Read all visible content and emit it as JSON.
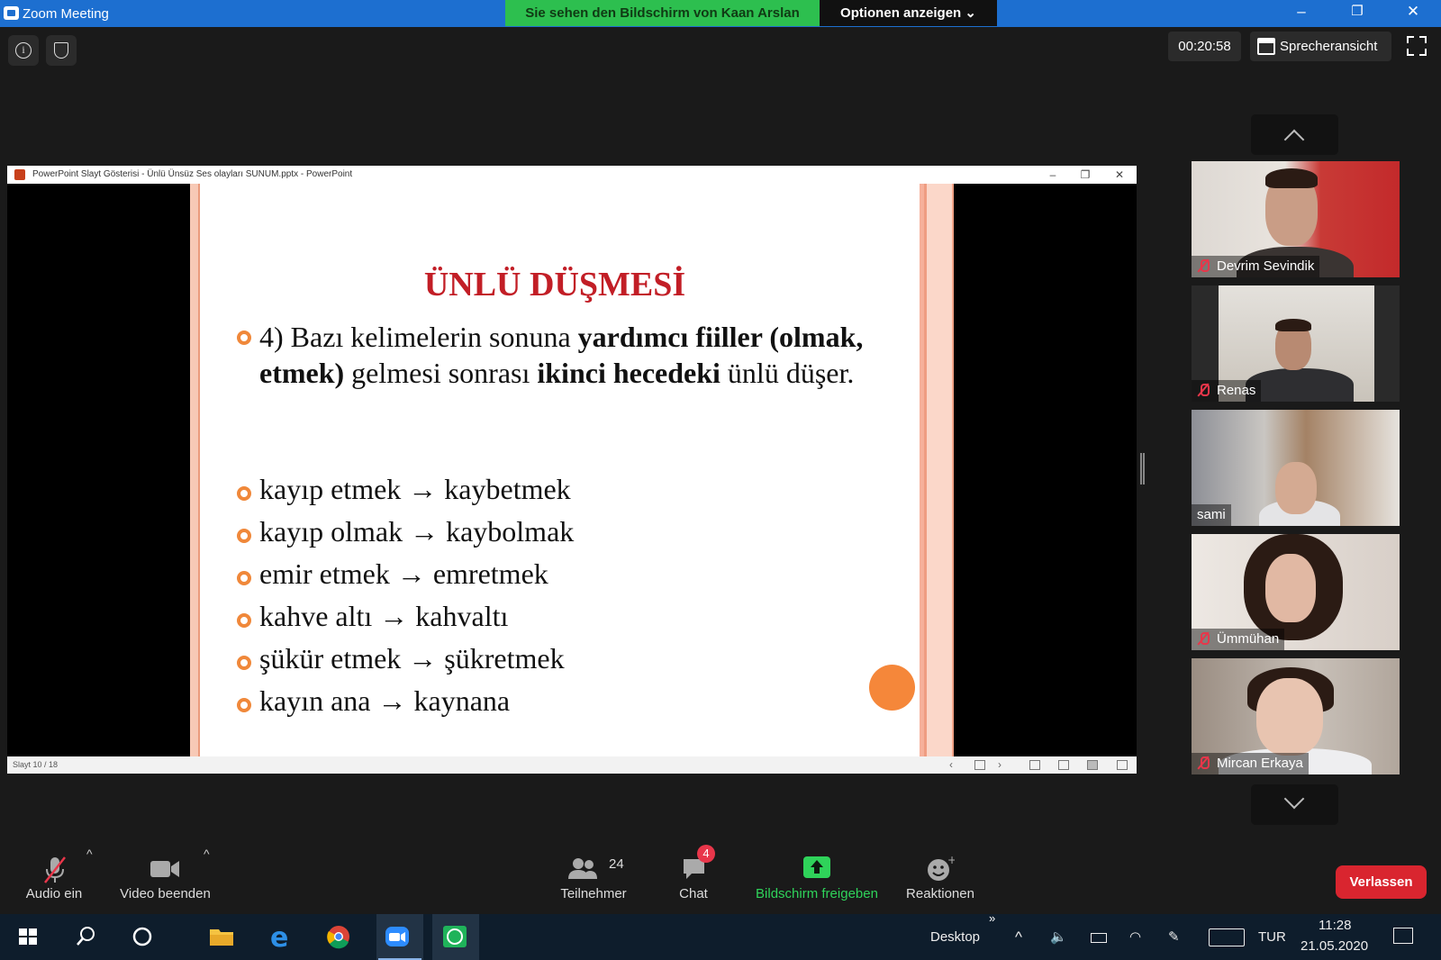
{
  "window": {
    "title": "Zoom Meeting",
    "share_banner": "Sie sehen den Bildschirm von Kaan Arslan",
    "options_button": "Optionen anzeigen",
    "controls": [
      "–",
      "❐",
      "✕"
    ]
  },
  "topbar": {
    "timer": "00:20:58",
    "view_button": "Sprecheransicht"
  },
  "powerpoint": {
    "titlebar": "PowerPoint Slayt Gösterisi  -  Ünlü Ünsüz Ses olayları SUNUM.pptx - PowerPoint",
    "status": "Slayt 10 / 18",
    "slide": {
      "title": "ÜNLÜ DÜŞMESİ",
      "para": {
        "p1": "4) Bazı kelimelerin sonuna ",
        "b1": "yardımcı fiiller (olmak, etmek)",
        "p2": " gelmesi sonrası ",
        "b2": "ikinci hecedeki",
        "p3": " ünlü düşer."
      },
      "examples": [
        "kayıp etmek → kaybetmek",
        "kayıp olmak → kaybolmak",
        "emir etmek → emretmek",
        "kahve altı → kahvaltı",
        "şükür etmek → şükretmek",
        "kayın ana → kaynana"
      ]
    }
  },
  "participants": [
    {
      "name": "Devrim Sevindik",
      "muted": true
    },
    {
      "name": "Renas",
      "muted": true
    },
    {
      "name": "sami",
      "muted": false
    },
    {
      "name": "Ümmühan",
      "muted": true
    },
    {
      "name": "Mircan Erkaya",
      "muted": true
    }
  ],
  "toolbar": {
    "audio": "Audio ein",
    "video": "Video beenden",
    "participants": "Teilnehmer",
    "participants_count": "24",
    "chat": "Chat",
    "chat_badge": "4",
    "share": "Bildschirm freigeben",
    "reactions": "Reaktionen",
    "leave": "Verlassen"
  },
  "taskbar": {
    "desktop": "Desktop",
    "lang": "TUR",
    "time": "11:28",
    "date": "21.05.2020"
  },
  "colors": {
    "zoom_blue": "#1d6fd0",
    "share_green": "#2dbf4f",
    "leave_red": "#d9252f",
    "slide_title_red": "#c21e26",
    "bullet_orange": "#f0883a"
  }
}
